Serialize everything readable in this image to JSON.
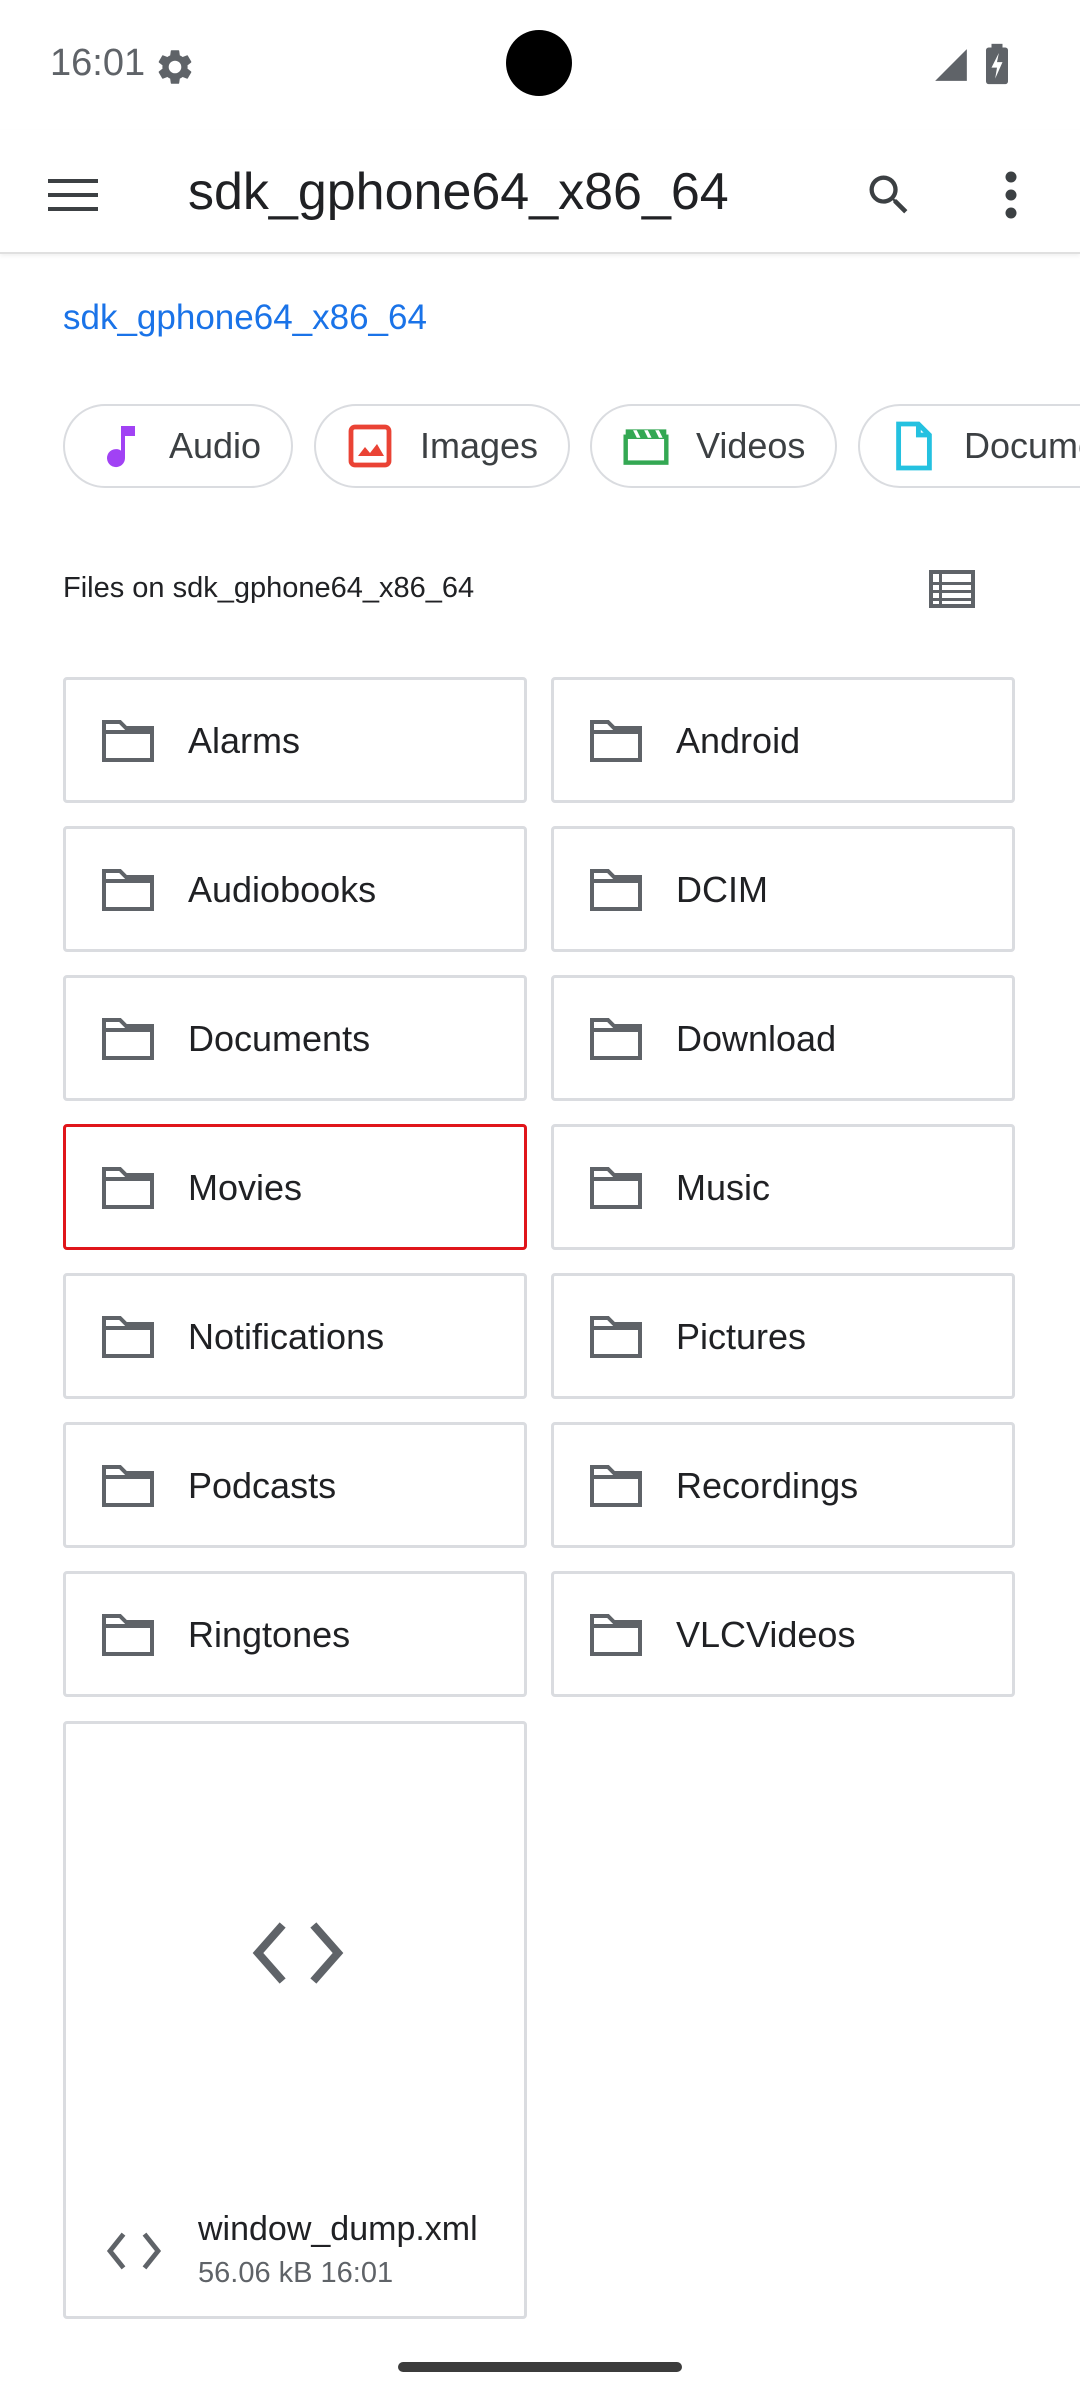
{
  "status_bar": {
    "time": "16:01"
  },
  "app_bar": {
    "title": "sdk_gphone64_x86_64"
  },
  "breadcrumb": "sdk_gphone64_x86_64",
  "chips": [
    {
      "label": "Audio",
      "icon": "music-note-icon",
      "color": "#a142f4"
    },
    {
      "label": "Images",
      "icon": "image-icon",
      "color": "#ea4335"
    },
    {
      "label": "Videos",
      "icon": "movie-icon",
      "color": "#34a853"
    },
    {
      "label": "Documents",
      "icon": "document-icon",
      "color": "#24c1e0"
    }
  ],
  "section_title": "Files on sdk_gphone64_x86_64",
  "folders": [
    {
      "name": "Alarms"
    },
    {
      "name": "Android"
    },
    {
      "name": "Audiobooks"
    },
    {
      "name": "DCIM"
    },
    {
      "name": "Documents"
    },
    {
      "name": "Download"
    },
    {
      "name": "Movies",
      "highlighted": true
    },
    {
      "name": "Music"
    },
    {
      "name": "Notifications"
    },
    {
      "name": "Pictures"
    },
    {
      "name": "Podcasts"
    },
    {
      "name": "Recordings"
    },
    {
      "name": "Ringtones"
    },
    {
      "name": "VLCVideos"
    }
  ],
  "file": {
    "name": "window_dump.xml",
    "size": "56.06 kB",
    "time": "16:01",
    "icon": "code-icon"
  },
  "colors": {
    "accent": "#1a73e8",
    "highlight": "#e0151b",
    "icon_gray": "#5f6368"
  }
}
